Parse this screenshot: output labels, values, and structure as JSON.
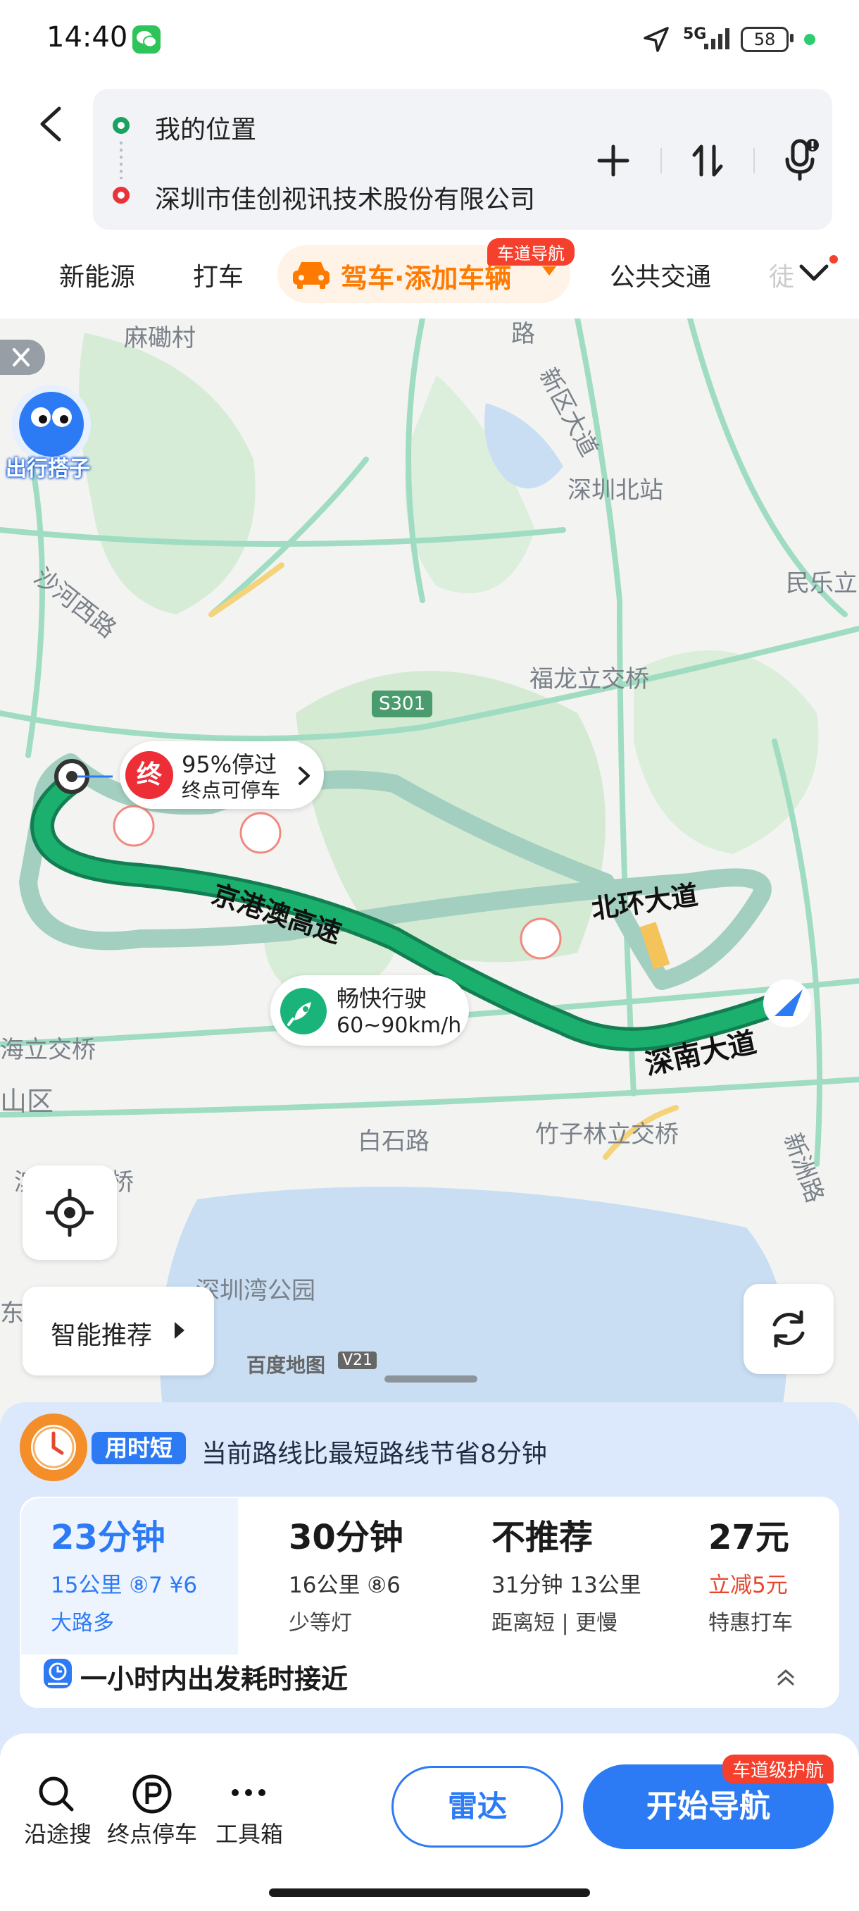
{
  "status_bar": {
    "time": "14:40",
    "network": "5G",
    "battery": "58"
  },
  "search": {
    "origin": "我的位置",
    "destination": "深圳市佳创视讯技术股份有限公司"
  },
  "mode_tabs": {
    "ev": "新能源",
    "taxi": "打车",
    "drive": "驾车·添加车辆",
    "drive_badge": "车道导航",
    "transit": "公共交通",
    "more_fade": "徒"
  },
  "map": {
    "labels": {
      "mawei_village": "麻磡村",
      "lu_top": "路",
      "xinqu_avenue": "新区大道",
      "shenzhen_north": "深圳北站",
      "minle": "民乐立",
      "shahe_west": "沙河西路",
      "fulong": "福龙立交桥",
      "s301": "S301",
      "jinggang": "京港澳高速",
      "beihuan": "北环大道",
      "shennan": "深南大道",
      "haishan": "海立交桥",
      "shan_district": "山区",
      "baishi": "白石路",
      "zhuzilin": "竹子林立交桥",
      "xinzhou": "新洲路",
      "xiyuan": "滨苑立交桥",
      "bay_park": "深圳湾公园",
      "dong": "东"
    },
    "mascot_label": "出行搭子",
    "end_marker_char": "终",
    "end_rate": "95%停过",
    "end_parking": "终点可停车",
    "speed_title": "畅快行驶",
    "speed_range": "60~90km/h",
    "smart_recommend": "智能推荐",
    "brand": "百度地图",
    "brand_version": "V21"
  },
  "sheet": {
    "fast_badge": "用时短",
    "save_note": "当前路线比最短路线节省8分钟",
    "routes": [
      {
        "time": "23分钟",
        "meta": "15公里 ⑧7 ¥6",
        "tag": "大路多"
      },
      {
        "time": "30分钟",
        "meta": "16公里 ⑧6",
        "tag": "少等灯"
      },
      {
        "time": "不推荐",
        "meta": "31分钟 13公里",
        "tag": "距离短 | 更慢"
      },
      {
        "time": "27元",
        "meta": "立减5元",
        "tag": "特惠打车"
      }
    ],
    "depart_note": "一小时内出发耗时接近"
  },
  "actions": {
    "search_along": "沿途搜",
    "end_parking": "终点停车",
    "toolbox": "工具箱",
    "radar": "雷达",
    "start_nav": "开始导航",
    "guard_badge": "车道级护航"
  },
  "colors": {
    "accent_blue": "#2d7bf4",
    "route_green": "#1bb06e",
    "alt_route": "#a3cfc0",
    "drive_orange": "#ff7a00",
    "badge_red": "#f5402e",
    "water": "#c9def3",
    "green_area": "#d7ecd6"
  }
}
